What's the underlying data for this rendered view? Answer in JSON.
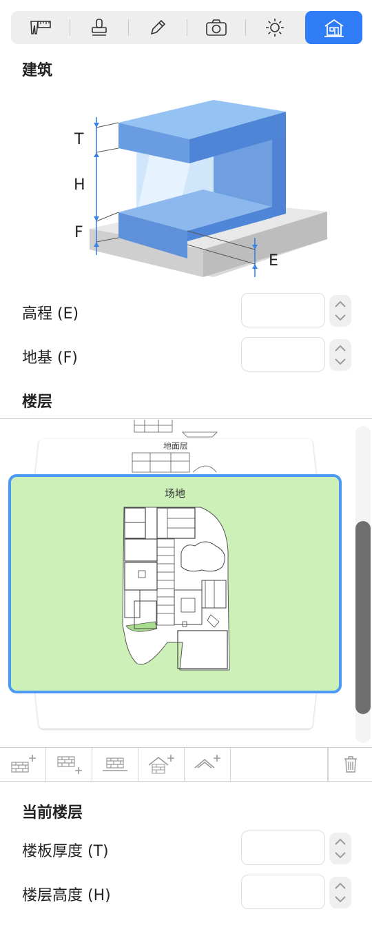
{
  "tabs": [
    {
      "icon": "measure-icon",
      "active": false
    },
    {
      "icon": "stamp-icon",
      "active": false
    },
    {
      "icon": "pencil-icon",
      "active": false
    },
    {
      "icon": "camera-icon",
      "active": false
    },
    {
      "icon": "sun-icon",
      "active": false
    },
    {
      "icon": "building-icon",
      "active": true
    }
  ],
  "building": {
    "title": "建筑",
    "diagram_labels": {
      "t": "T",
      "h": "H",
      "f": "F",
      "e": "E"
    },
    "elevation_label": "高程 (E)",
    "elevation_value": "",
    "foundation_label": "地基 (F)",
    "foundation_value": ""
  },
  "floors": {
    "title": "楼层",
    "cards": [
      {
        "label": "地面层"
      },
      {
        "label": "场地"
      }
    ],
    "toolbar": [
      "add-floor-above-icon",
      "add-floor-below-icon",
      "floor-icon",
      "add-roof-floor-icon",
      "add-roof-icon",
      "trash-icon"
    ]
  },
  "current_floor": {
    "title": "当前楼层",
    "slab_label": "楼板厚度 (T)",
    "slab_value": "",
    "height_label": "楼层高度 (H)",
    "height_value": ""
  },
  "colors": {
    "accent": "#2f7cf6",
    "site_green": "#ccf0b8",
    "selection": "#4a9af5"
  }
}
